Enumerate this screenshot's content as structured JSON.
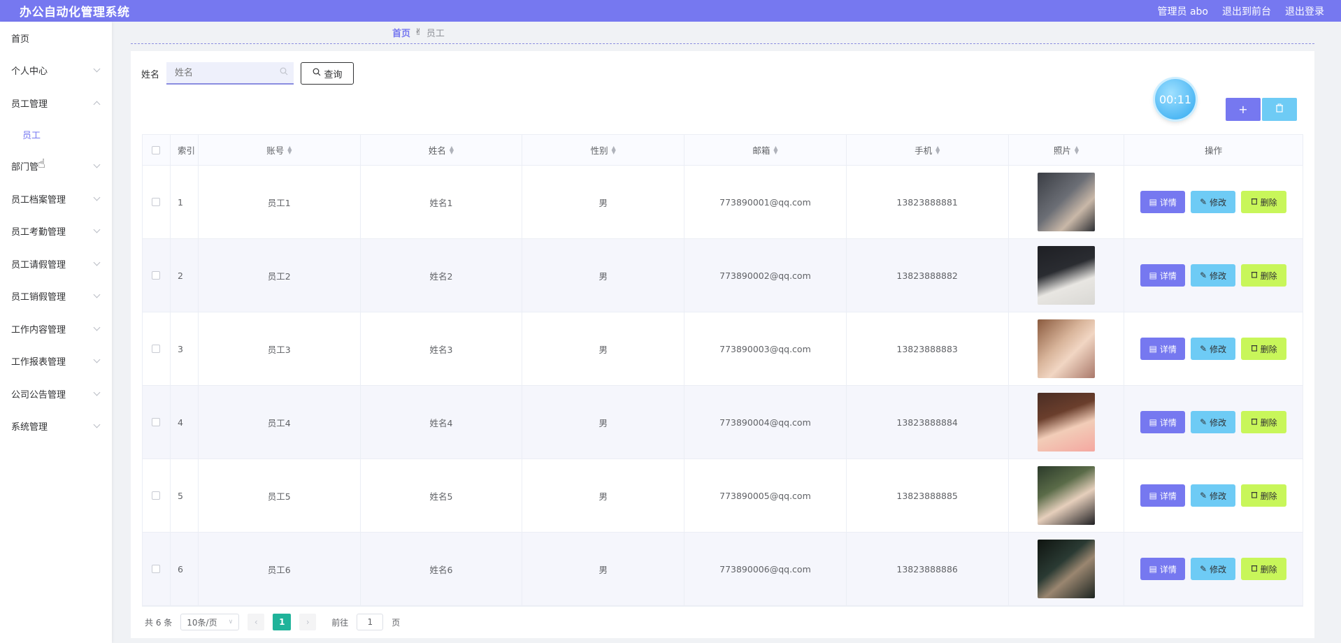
{
  "header": {
    "title": "办公自动化管理系统",
    "user": "管理员 abo",
    "to_front": "退出到前台",
    "logout": "退出登录"
  },
  "sidebar": {
    "items": [
      {
        "label": "首页",
        "chevron": "none"
      },
      {
        "label": "个人中心",
        "chevron": "down"
      },
      {
        "label": "员工管理",
        "chevron": "up"
      },
      {
        "label": "员工",
        "sub": true
      },
      {
        "label": "部门管",
        "chevron": "down"
      },
      {
        "label": "员工档案管理",
        "chevron": "down"
      },
      {
        "label": "员工考勤管理",
        "chevron": "down"
      },
      {
        "label": "员工请假管理",
        "chevron": "down"
      },
      {
        "label": "员工销假管理",
        "chevron": "down"
      },
      {
        "label": "工作内容管理",
        "chevron": "down"
      },
      {
        "label": "工作报表管理",
        "chevron": "down"
      },
      {
        "label": "公司公告管理",
        "chevron": "down"
      },
      {
        "label": "系统管理",
        "chevron": "down"
      }
    ]
  },
  "breadcrumb": {
    "home": "首页",
    "separator_icon": "hand-icon",
    "current": "员工"
  },
  "search": {
    "label": "姓名",
    "placeholder": "姓名",
    "button": "查询"
  },
  "timer": "00:11",
  "toolbar": {
    "add": "+",
    "delete_icon": "trash-icon"
  },
  "table": {
    "columns": [
      "索引",
      "账号",
      "姓名",
      "性别",
      "邮箱",
      "手机",
      "照片",
      "操作"
    ],
    "rows": [
      {
        "index": "1",
        "account": "员工1",
        "name": "姓名1",
        "gender": "男",
        "email": "773890001@qq.com",
        "phone": "13823888881"
      },
      {
        "index": "2",
        "account": "员工2",
        "name": "姓名2",
        "gender": "男",
        "email": "773890002@qq.com",
        "phone": "13823888882"
      },
      {
        "index": "3",
        "account": "员工3",
        "name": "姓名3",
        "gender": "男",
        "email": "773890003@qq.com",
        "phone": "13823888883"
      },
      {
        "index": "4",
        "account": "员工4",
        "name": "姓名4",
        "gender": "男",
        "email": "773890004@qq.com",
        "phone": "13823888884"
      },
      {
        "index": "5",
        "account": "员工5",
        "name": "姓名5",
        "gender": "男",
        "email": "773890005@qq.com",
        "phone": "13823888885"
      },
      {
        "index": "6",
        "account": "员工6",
        "name": "姓名6",
        "gender": "男",
        "email": "773890006@qq.com",
        "phone": "13823888886"
      }
    ],
    "ops": {
      "detail": "详情",
      "edit": "修改",
      "delete": "删除"
    }
  },
  "pagination": {
    "total": "共 6 条",
    "page_size": "10条/页",
    "current_page": "1",
    "goto_label": "前往",
    "goto_value": "1",
    "page_suffix": "页"
  },
  "colors": {
    "header": "#7678f0",
    "detail": "#7678f0",
    "edit": "#6ecbf5",
    "delete": "#c8f65a",
    "page_active": "#1fb39a"
  }
}
